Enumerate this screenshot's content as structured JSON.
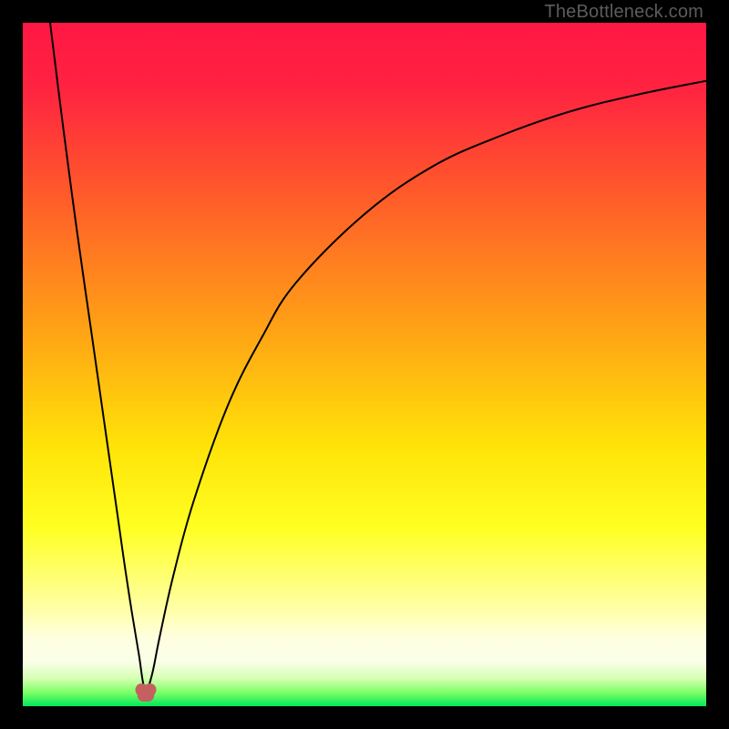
{
  "watermark": "TheBottleneck.com",
  "colors": {
    "frame": "#000000",
    "gradient_stops": [
      {
        "offset": 0.0,
        "color": "#ff1744"
      },
      {
        "offset": 0.1,
        "color": "#ff2440"
      },
      {
        "offset": 0.25,
        "color": "#ff5a2a"
      },
      {
        "offset": 0.45,
        "color": "#ffa315"
      },
      {
        "offset": 0.62,
        "color": "#ffe308"
      },
      {
        "offset": 0.74,
        "color": "#ffff22"
      },
      {
        "offset": 0.8,
        "color": "#ffff66"
      },
      {
        "offset": 0.86,
        "color": "#ffffaa"
      },
      {
        "offset": 0.9,
        "color": "#ffffe0"
      },
      {
        "offset": 0.935,
        "color": "#faffe8"
      },
      {
        "offset": 0.96,
        "color": "#d4ffb0"
      },
      {
        "offset": 0.98,
        "color": "#7cff66"
      },
      {
        "offset": 1.0,
        "color": "#00e85a"
      }
    ],
    "curve": "#000000",
    "marker": "#c46060"
  },
  "chart_data": {
    "type": "line",
    "title": "",
    "xlabel": "",
    "ylabel": "",
    "xlim": [
      0,
      100
    ],
    "ylim": [
      0,
      100
    ],
    "x_minimum": 18,
    "series": [
      {
        "name": "left-branch",
        "x": [
          4,
          6,
          8,
          10,
          12,
          14,
          15,
          16,
          17,
          17.5,
          18
        ],
        "y": [
          100,
          84,
          69,
          55,
          41,
          27,
          20,
          13.5,
          7.5,
          4,
          1.5
        ]
      },
      {
        "name": "right-branch",
        "x": [
          18,
          19,
          20,
          22,
          25,
          30,
          35,
          40,
          50,
          60,
          70,
          80,
          90,
          100
        ],
        "y": [
          1.5,
          5,
          10,
          19,
          30,
          44,
          54,
          62,
          72,
          79,
          83.5,
          87,
          89.5,
          91.5
        ]
      }
    ],
    "markers": [
      {
        "x": 17.4,
        "y": 2.4
      },
      {
        "x": 17.7,
        "y": 1.6
      },
      {
        "x": 18.3,
        "y": 1.6
      },
      {
        "x": 18.6,
        "y": 2.4
      }
    ],
    "annotations": []
  }
}
